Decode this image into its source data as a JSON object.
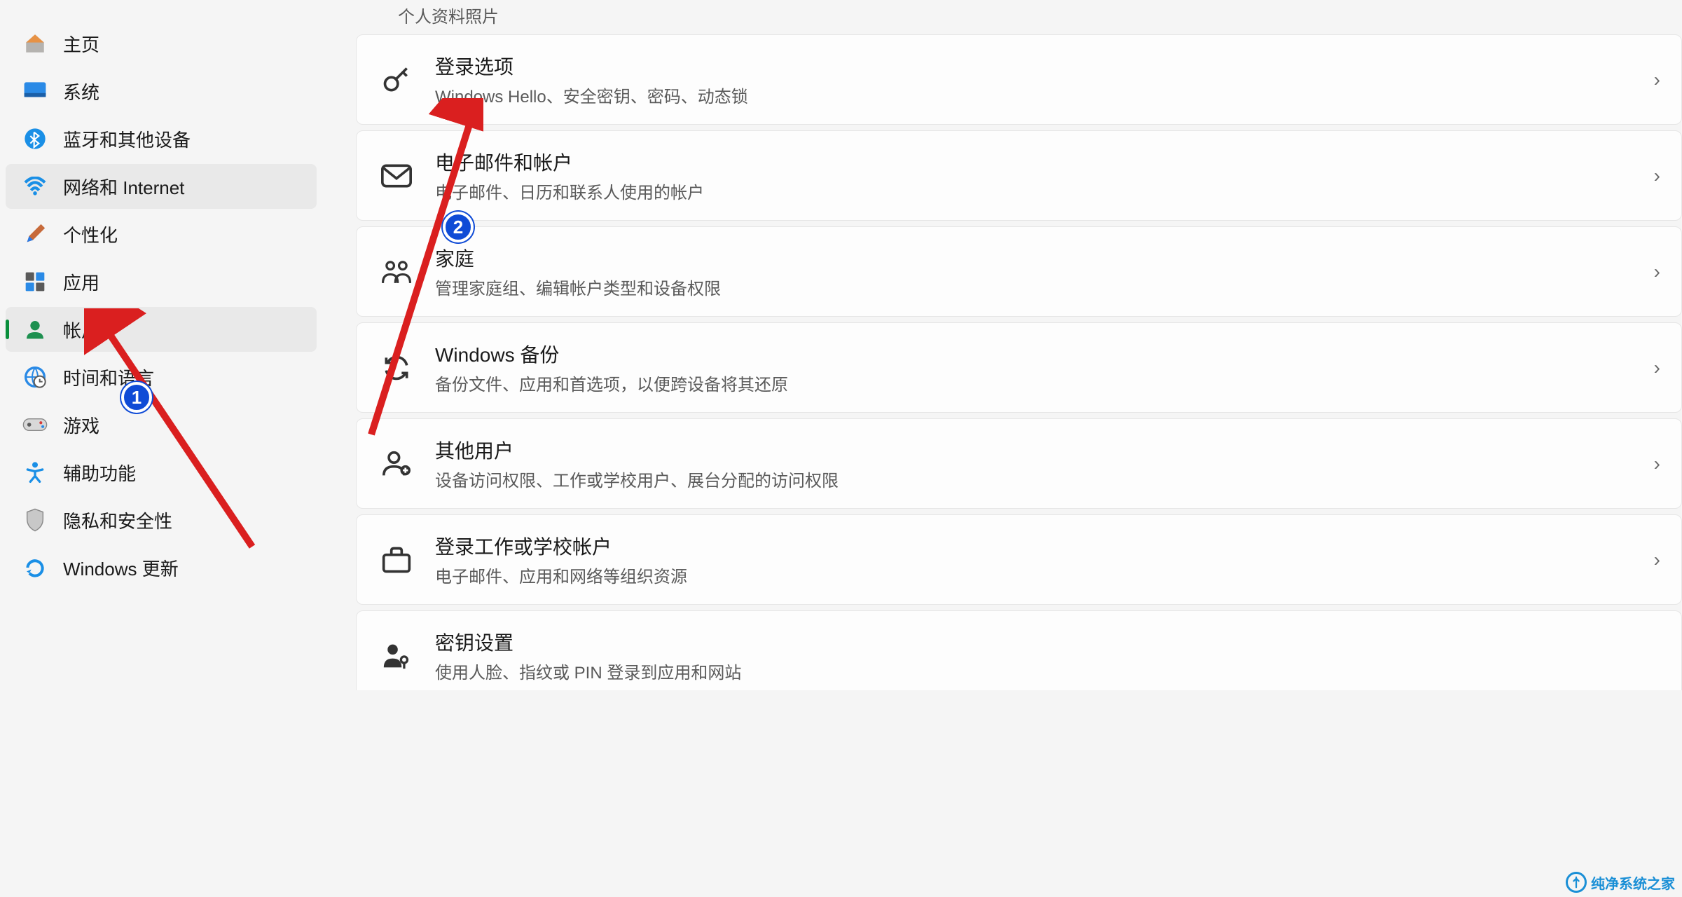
{
  "sidebar": {
    "items": [
      {
        "label": "主页"
      },
      {
        "label": "系统"
      },
      {
        "label": "蓝牙和其他设备"
      },
      {
        "label": "网络和 Internet"
      },
      {
        "label": "个性化"
      },
      {
        "label": "应用"
      },
      {
        "label": "帐户"
      },
      {
        "label": "时间和语言"
      },
      {
        "label": "游戏"
      },
      {
        "label": "辅助功能"
      },
      {
        "label": "隐私和安全性"
      },
      {
        "label": "Windows 更新"
      }
    ]
  },
  "header_partial": "个人资料照片",
  "cards": {
    "signin": {
      "title": "登录选项",
      "sub": "Windows Hello、安全密钥、密码、动态锁"
    },
    "email": {
      "title": "电子邮件和帐户",
      "sub": "电子邮件、日历和联系人使用的帐户"
    },
    "family": {
      "title": "家庭",
      "sub": "管理家庭组、编辑帐户类型和设备权限"
    },
    "backup": {
      "title": "Windows 备份",
      "sub": "备份文件、应用和首选项，以便跨设备将其还原"
    },
    "other_users": {
      "title": "其他用户",
      "sub": "设备访问权限、工作或学校用户、展台分配的访问权限"
    },
    "work_school": {
      "title": "登录工作或学校帐户",
      "sub": "电子邮件、应用和网络等组织资源"
    },
    "passkey": {
      "title": "密钥设置",
      "sub": "使用人脸、指纹或 PIN 登录到应用和网站"
    }
  },
  "annotations": {
    "badge1": "1",
    "badge2": "2"
  },
  "watermark": "纯净系统之家"
}
